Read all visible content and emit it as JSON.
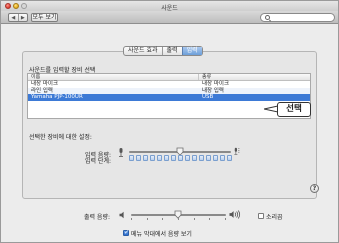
{
  "window": {
    "title": "사운드"
  },
  "toolbar": {
    "back_glyph": "◀",
    "forward_glyph": "▶",
    "show_all_label": "모두 보기",
    "search_placeholder": ""
  },
  "tabs": [
    {
      "label": "사운드 효과",
      "active": false
    },
    {
      "label": "출력",
      "active": false
    },
    {
      "label": "입력",
      "active": true
    }
  ],
  "input": {
    "section_title": "사운드를 입력할 장비 선택",
    "columns": [
      "이름",
      "종류"
    ],
    "rows": [
      {
        "name": "내장 마이크",
        "type": "내장 마이크",
        "selected": false
      },
      {
        "name": "라인 입력",
        "type": "내장 입력",
        "selected": false
      },
      {
        "name": "Yamaha PJP-100UR",
        "type": "USB",
        "selected": true
      }
    ],
    "callout": "선택",
    "settings_title": "선택한 장비에 대한 설정:",
    "volume_label": "입력 음량:",
    "volume_level": 0.5,
    "level_label": "입력 단계:",
    "level_segments": 15
  },
  "help_glyph": "?",
  "output": {
    "volume_label": "출력 음량:",
    "volume_level": 0.5,
    "mute_label": "소리끔",
    "mute_checked": false,
    "menubar_label": "메뉴 막대에서 음량 보기",
    "menubar_checked": true
  },
  "colors": {
    "selection": "#3d7ad6",
    "active_tab": "#6d9fd9",
    "close": "#e0443a",
    "minimize": "#e6b125"
  }
}
